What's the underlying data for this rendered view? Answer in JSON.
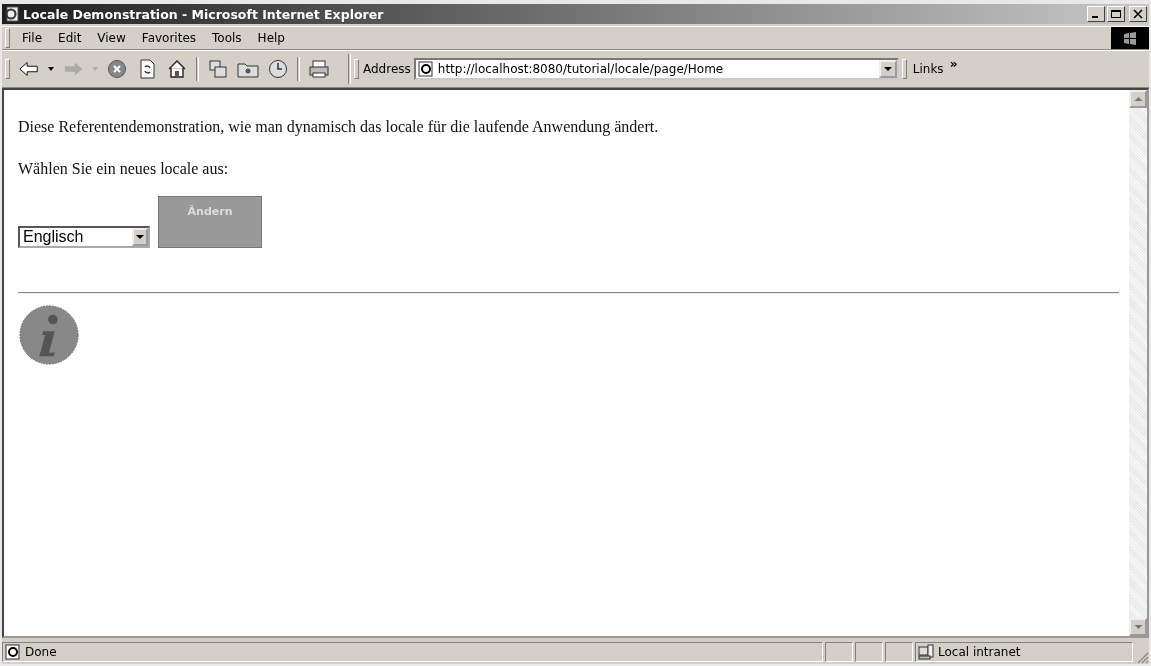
{
  "window": {
    "title": "Locale Demonstration - Microsoft Internet Explorer"
  },
  "menu": [
    "File",
    "Edit",
    "View",
    "Favorites",
    "Tools",
    "Help"
  ],
  "address_bar": {
    "label": "Address",
    "value": "http://localhost:8080/tutorial/locale/page/Home"
  },
  "links": {
    "label": "Links",
    "more": "»"
  },
  "page": {
    "intro": "Diese Referentendemonstration, wie man dynamisch das locale für die laufende Anwendung ändert.",
    "prompt": "Wählen Sie ein neues locale aus:",
    "locale_select": {
      "value": "Englisch"
    },
    "change_button": {
      "label": "Ändern",
      "disabled": true
    }
  },
  "status_bar": {
    "text": "Done",
    "zone": "Local intranet"
  }
}
